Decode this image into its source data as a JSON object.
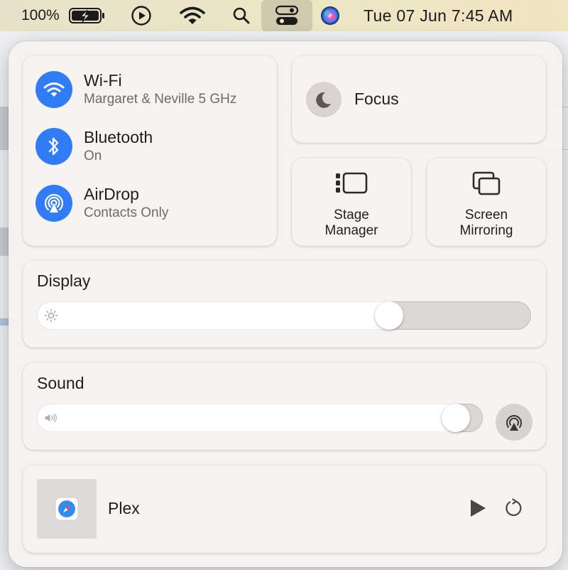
{
  "menubar": {
    "battery_percent": "100%",
    "clock": "Tue 07 Jun  7:45 AM",
    "icons": [
      "battery-charging-icon",
      "play-circle-icon",
      "wifi-icon",
      "search-icon",
      "control-center-icon",
      "siri-icon"
    ]
  },
  "control_center": {
    "connectivity": [
      {
        "title": "Wi-Fi",
        "subtitle": "Margaret & Neville 5 GHz",
        "icon": "wifi-icon"
      },
      {
        "title": "Bluetooth",
        "subtitle": "On",
        "icon": "bluetooth-icon"
      },
      {
        "title": "AirDrop",
        "subtitle": "Contacts Only",
        "icon": "airdrop-icon"
      }
    ],
    "focus": {
      "label": "Focus",
      "icon": "moon-icon"
    },
    "stage_manager": {
      "line1": "Stage",
      "line2": "Manager",
      "icon": "stage-manager-icon"
    },
    "screen_mirroring": {
      "line1": "Screen",
      "line2": "Mirroring",
      "icon": "screen-mirroring-icon"
    },
    "display": {
      "title": "Display",
      "brightness": 0.725,
      "icon": "sun-icon"
    },
    "sound": {
      "title": "Sound",
      "volume": 0.97,
      "icon": "speaker-icon",
      "output_icon": "airplay-audio-icon"
    },
    "now_playing": {
      "title": "Plex",
      "app_icon": "safari-icon"
    },
    "accent_color": "#2f7cf6"
  }
}
